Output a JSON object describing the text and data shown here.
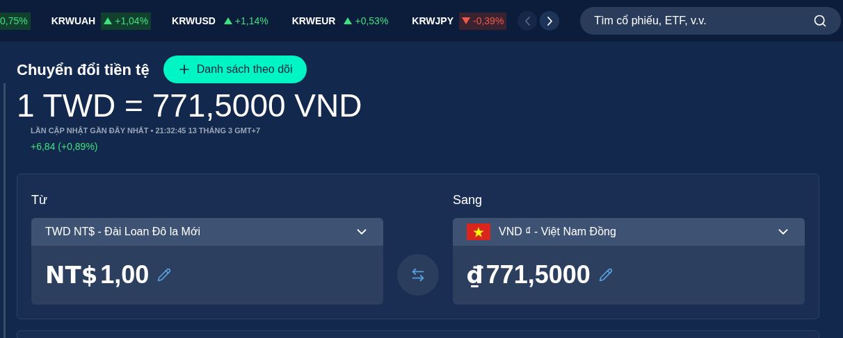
{
  "ticker": [
    {
      "change": "0,75%",
      "kind": "up",
      "highlighted": true
    },
    {
      "symbol": "KRWUAH",
      "change": "+1,04%",
      "kind": "up",
      "highlighted": true
    },
    {
      "symbol": "KRWUSD",
      "change": "+1,14%",
      "kind": "up",
      "highlighted": false
    },
    {
      "symbol": "KRWEUR",
      "change": "+0,53%",
      "kind": "up",
      "highlighted": false
    },
    {
      "symbol": "KRWJPY",
      "change": "-0,39%",
      "kind": "down",
      "highlighted": true
    }
  ],
  "ticker_nav": {
    "prev_disabled": true,
    "next_disabled": false
  },
  "search": {
    "placeholder": "Tìm cổ phiếu, ETF, v.v."
  },
  "title": "Chuyển đổi tiền tệ",
  "watchlist_button": "Danh sách theo dõi",
  "rate": "1 TWD = 771,5000 VND",
  "updated": "LẦN CẬP NHẬT GẦN ĐÂY NHẤT • 21:32:45 13 THÁNG 3 GMT+7",
  "rate_change": {
    "text": "+6,84 (+0,89%)",
    "kind": "up"
  },
  "converter": [
    {
      "label": "Từ",
      "currency": "TWD NT$ - Đài Loan Đô la Mới",
      "flag": false,
      "symbol": "NT$",
      "amount": "1,00"
    },
    {
      "label": "Sang",
      "currency": "VND ₫ - Việt Nam Đồng",
      "flag": true,
      "symbol": "₫",
      "amount": "771,5000"
    }
  ]
}
